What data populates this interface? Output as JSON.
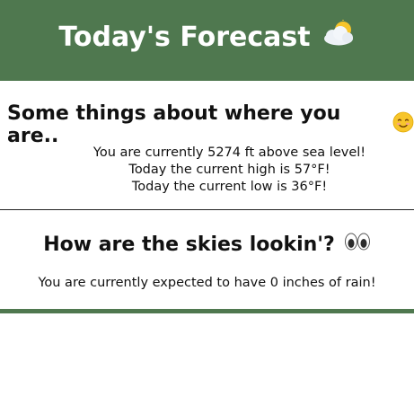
{
  "header": {
    "title": "Today's Forecast",
    "icon": "sun-behind-cloud-icon",
    "background_color": "#4f784f"
  },
  "location_section": {
    "title": "Some things about where you are..",
    "icon": "smiling-face-icon",
    "lines": [
      "You are currently 5274 ft above sea level!",
      "Today the current high is 57°F!",
      "Today the current low is 36°F!"
    ]
  },
  "sky_section": {
    "title": "How are the skies lookin'?",
    "icon": "eyes-icon",
    "line": "You are currently expected to have 0 inches of rain!"
  }
}
